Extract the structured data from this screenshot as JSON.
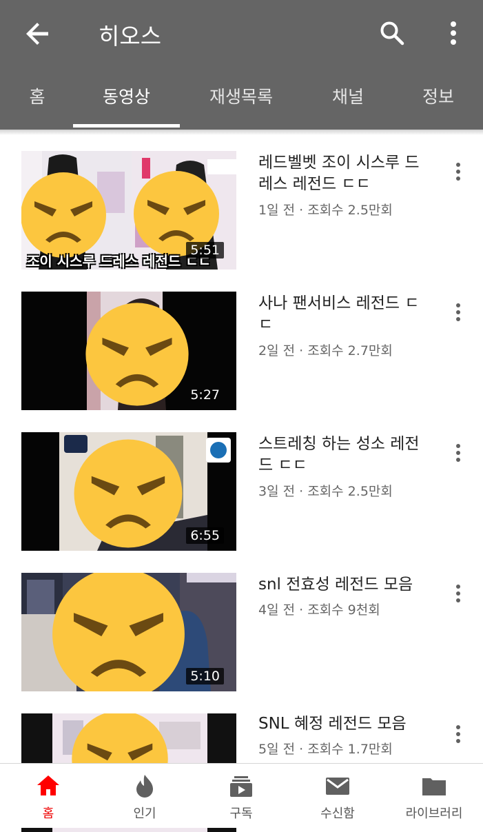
{
  "header": {
    "title": "히오스",
    "tabs": [
      {
        "label": "홈"
      },
      {
        "label": "동영상"
      },
      {
        "label": "재생목록"
      },
      {
        "label": "채널"
      },
      {
        "label": "정보"
      }
    ],
    "active_tab": "동영상",
    "bar_color": "#656565"
  },
  "videos": [
    {
      "title": "레드벨벳 조이 시스루 드레스 레전드 ㄷㄷ",
      "meta": "1일 전 · 조회수 2.5만회",
      "duration": "5:51",
      "caption": "조이 시스루 드레스 레전드 ㄷㄷ"
    },
    {
      "title": "사나 팬서비스 레전드 ㄷㄷ",
      "meta": "2일 전 · 조회수 2.7만회",
      "duration": "5:27"
    },
    {
      "title": "스트레칭 하는 성소 레전드 ㄷㄷ",
      "meta": "3일 전 · 조회수 2.5만회",
      "duration": "6:55"
    },
    {
      "title": "snl 전효성 레전드 모음",
      "meta": "4일 전 · 조회수 9천회",
      "duration": "5:10"
    },
    {
      "title": "SNL 혜정 레전드 모음",
      "meta": "5일 전 · 조회수 1.7만회",
      "duration": ""
    }
  ],
  "bottom_nav": [
    {
      "label": "홈",
      "icon": "home-icon",
      "active": true
    },
    {
      "label": "인기",
      "icon": "trending-icon",
      "active": false
    },
    {
      "label": "구독",
      "icon": "subscriptions-icon",
      "active": false
    },
    {
      "label": "수신함",
      "icon": "inbox-icon",
      "active": false
    },
    {
      "label": "라이브러리",
      "icon": "library-icon",
      "active": false
    }
  ],
  "colors": {
    "accent": "#ff0000",
    "emoji": "#fcc63f"
  }
}
